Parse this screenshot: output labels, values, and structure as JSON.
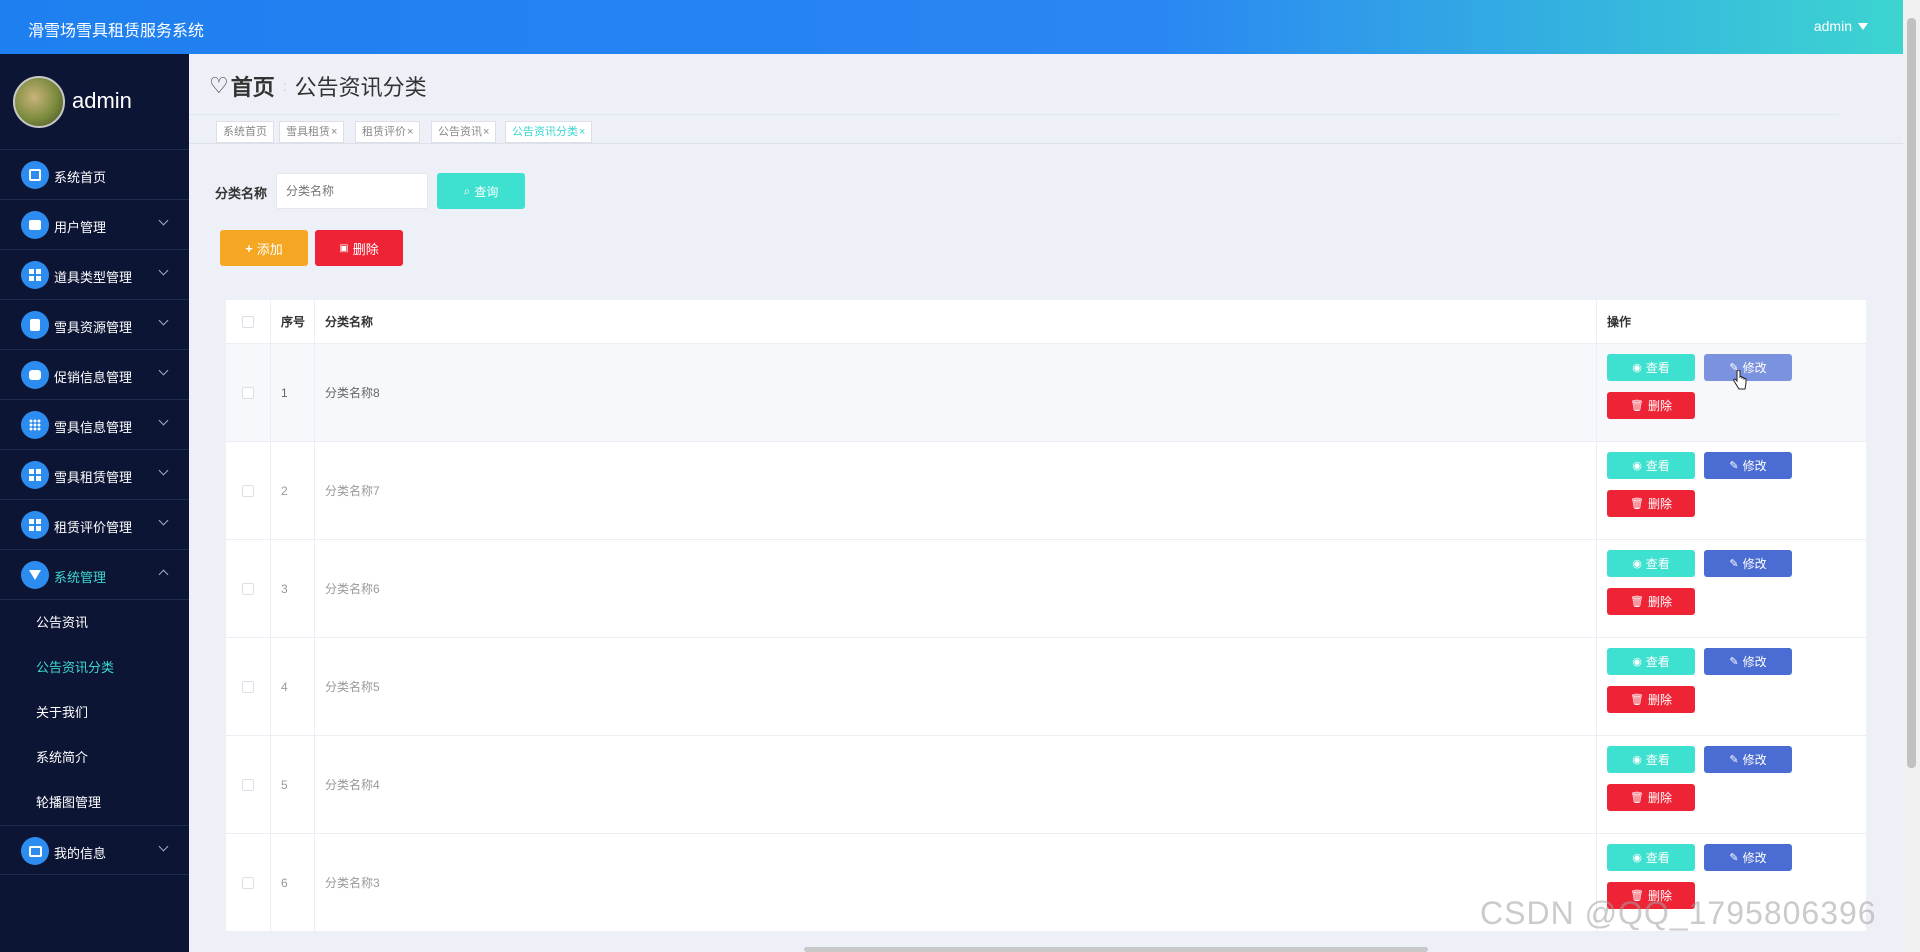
{
  "app": {
    "title": "滑雪场雪具租赁服务系统",
    "user": "admin"
  },
  "sidebar": {
    "profile_name": "admin",
    "items": [
      {
        "label": "系统首页",
        "icon": "home-icon"
      },
      {
        "label": "用户管理",
        "icon": "briefcase-icon"
      },
      {
        "label": "道具类型管理",
        "icon": "grid-icon"
      },
      {
        "label": "雪具资源管理",
        "icon": "clipboard-icon"
      },
      {
        "label": "促销信息管理",
        "icon": "chat-icon"
      },
      {
        "label": "雪具信息管理",
        "icon": "apps-icon"
      },
      {
        "label": "雪具租赁管理",
        "icon": "grid-icon"
      },
      {
        "label": "租赁评价管理",
        "icon": "grid-icon"
      },
      {
        "label": "系统管理",
        "icon": "funnel-icon"
      },
      {
        "label": "我的信息",
        "icon": "card-icon"
      }
    ],
    "subitems": [
      "公告资讯",
      "公告资讯分类",
      "关于我们",
      "系统简介",
      "轮播图管理"
    ]
  },
  "breadcrumb": {
    "home": "首页",
    "current": "公告资讯分类"
  },
  "tags": [
    {
      "label": "系统首页",
      "closable": false
    },
    {
      "label": "雪具租赁",
      "closable": true
    },
    {
      "label": "租赁评价",
      "closable": true
    },
    {
      "label": "公告资讯",
      "closable": true
    },
    {
      "label": "公告资讯分类",
      "closable": true
    }
  ],
  "search": {
    "label": "分类名称",
    "placeholder": "分类名称",
    "button": "查询"
  },
  "actions": {
    "add": "添加",
    "delete": "删除"
  },
  "table": {
    "headers": {
      "index": "序号",
      "name": "分类名称",
      "ops": "操作"
    },
    "rows": [
      {
        "index": "1",
        "name": "分类名称8"
      },
      {
        "index": "2",
        "name": "分类名称7"
      },
      {
        "index": "3",
        "name": "分类名称6"
      },
      {
        "index": "4",
        "name": "分类名称5"
      },
      {
        "index": "5",
        "name": "分类名称4"
      },
      {
        "index": "6",
        "name": "分类名称3"
      }
    ],
    "op_labels": {
      "view": "查看",
      "edit": "修改",
      "delete": "删除"
    }
  },
  "watermark": "CSDN @QQ_1795806396",
  "colors": {
    "accent": "#3ee0cf",
    "primary": "#4b6cd2",
    "danger": "#ee2436",
    "warning": "#f5a623",
    "sidebar": "#0d1535"
  }
}
